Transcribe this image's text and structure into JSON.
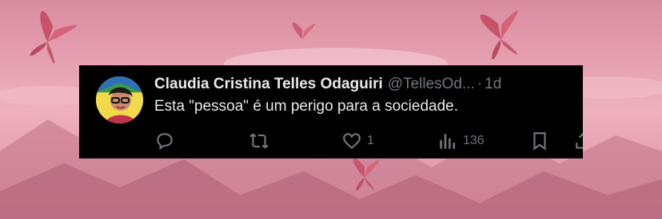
{
  "tweet": {
    "display_name": "Claudia Cristina Telles Odaguiri",
    "handle": "@TellesOd...",
    "separator": "·",
    "time": "1d",
    "text": "Esta \"pessoa\" é um perigo para a sociedade."
  },
  "actions": {
    "reply_count": "",
    "retweet_count": "",
    "like_count": "1",
    "views_count": "136"
  },
  "icons": {
    "reply": "reply-icon",
    "retweet": "retweet-icon",
    "like": "heart-icon",
    "views": "views-icon",
    "bookmark": "bookmark-icon",
    "share": "share-icon"
  },
  "colors": {
    "card_background": "#000000",
    "primary_text": "#e7e9ea",
    "secondary_text": "#71767b",
    "page_background": "#e9a3b3"
  }
}
